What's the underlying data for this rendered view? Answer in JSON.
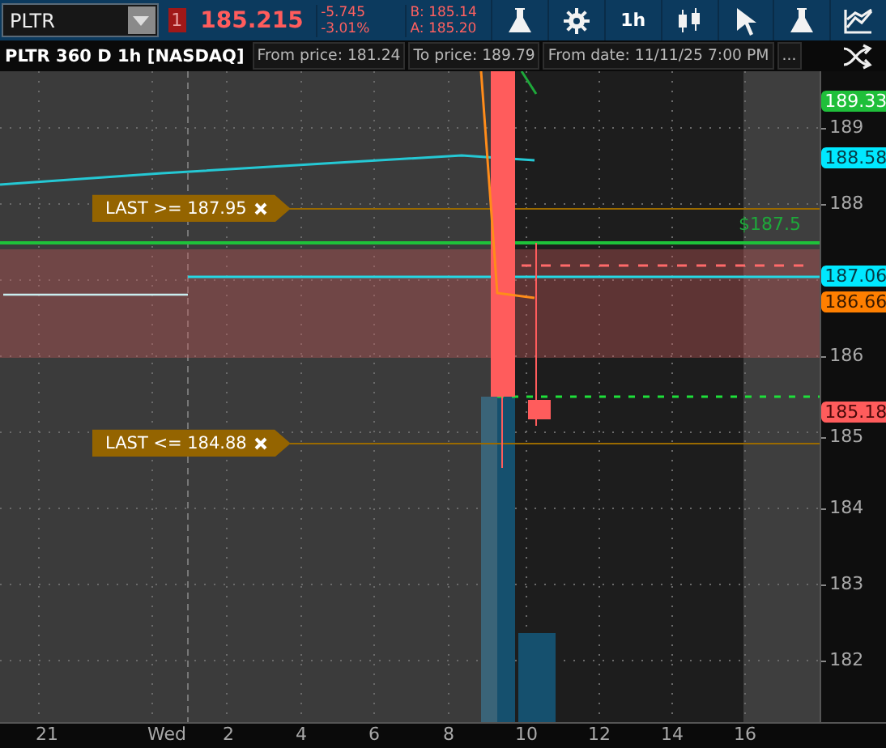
{
  "toolbar": {
    "symbol": "PLTR",
    "link_badge": "1",
    "last": "185.215",
    "change": "-5.745",
    "change_pct": "-3.01%",
    "bid": "B: 185.14",
    "ask": "A: 185.20",
    "buttons": [
      {
        "kind": "flask"
      },
      {
        "kind": "gear"
      },
      {
        "kind": "text",
        "label": "1h"
      },
      {
        "kind": "candles"
      },
      {
        "kind": "cursor"
      },
      {
        "kind": "flask"
      },
      {
        "kind": "drawing"
      }
    ]
  },
  "header": {
    "title": "PLTR 360 D 1h [NASDAQ]",
    "fields": [
      "From price: 181.24",
      "To price: 189.79",
      "From date: 11/11/25 7:00 PM",
      "..."
    ]
  },
  "chart": {
    "alerts": [
      "LAST >= 187.95",
      "LAST <= 184.88"
    ],
    "price_note": "$187.5",
    "y_axis": [
      "189",
      "188",
      "186",
      "185",
      "184",
      "183",
      "182"
    ],
    "price_badges": [
      {
        "text": "189.33",
        "color": "#1fbf3a"
      },
      {
        "text": "188.58",
        "color": "#00e8ff"
      },
      {
        "text": "187.06",
        "color": "#00e8ff"
      },
      {
        "text": "186.66",
        "color": "#ff7f00"
      },
      {
        "text": "185.18",
        "color": "#ff5c5c"
      }
    ],
    "x_axis": [
      "21",
      "Wed",
      "2",
      "4",
      "6",
      "8",
      "10",
      "12",
      "14",
      "16"
    ]
  }
}
